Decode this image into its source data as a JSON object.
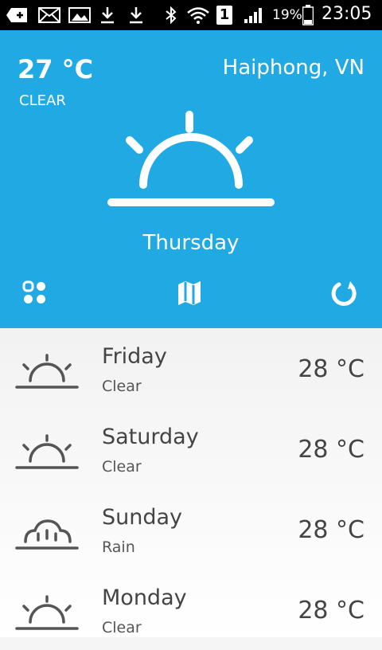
{
  "status_bar": {
    "signal_number": "1",
    "battery_percent": "19%",
    "time": "23:05"
  },
  "current": {
    "temperature": "27 °C",
    "condition": "CLEAR",
    "location": "Haiphong, VN",
    "day": "Thursday",
    "icon": "sunrise-icon"
  },
  "actions": {
    "grid_icon": "grid-icon",
    "map_icon": "map-icon",
    "refresh_icon": "refresh-icon"
  },
  "forecast": [
    {
      "day": "Friday",
      "condition": "Clear",
      "temperature": "28 °C",
      "icon": "sunrise-icon"
    },
    {
      "day": "Saturday",
      "condition": "Clear",
      "temperature": "28 °C",
      "icon": "sunrise-icon"
    },
    {
      "day": "Sunday",
      "condition": "Rain",
      "temperature": "28 °C",
      "icon": "rain-icon"
    },
    {
      "day": "Monday",
      "condition": "Clear",
      "temperature": "28 °C",
      "icon": "sunrise-icon"
    }
  ],
  "colors": {
    "accent": "#21a9e3",
    "text_dark": "#444444"
  }
}
